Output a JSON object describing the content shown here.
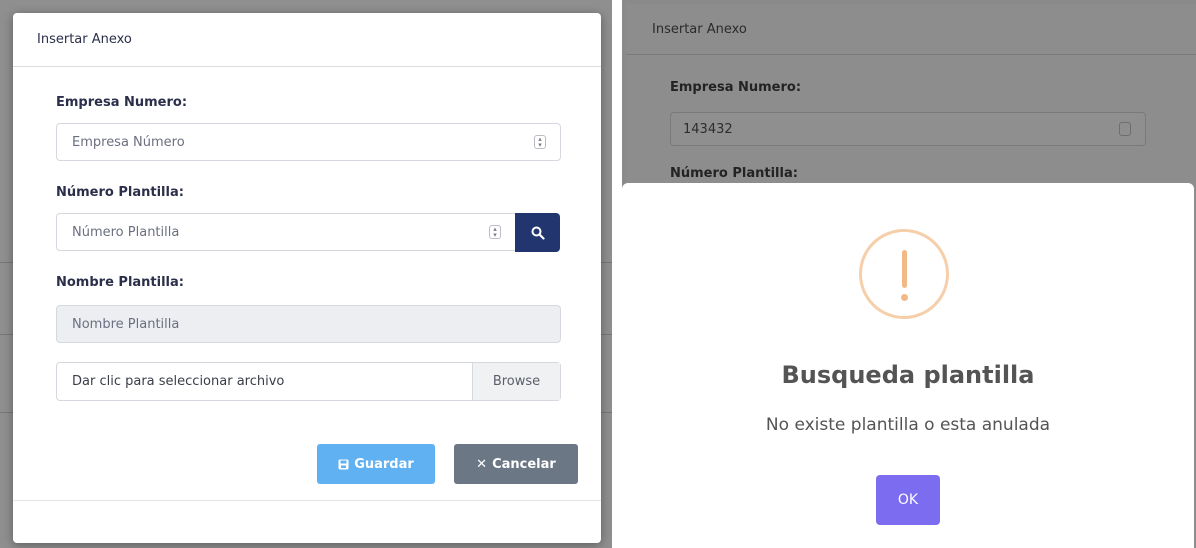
{
  "left_modal": {
    "title": "Insertar Anexo",
    "empresa_label": "Empresa Numero:",
    "empresa_placeholder": "Empresa Número",
    "plantilla_label": "Número Plantilla:",
    "plantilla_placeholder": "Número Plantilla",
    "nombre_label": "Nombre Plantilla:",
    "nombre_placeholder": "Nombre Plantilla",
    "file_placeholder": "Dar clic para seleccionar archivo",
    "browse_label": "Browse",
    "save_label": "Guardar",
    "cancel_label": "Cancelar"
  },
  "right_background": {
    "title": "Insertar Anexo",
    "empresa_label": "Empresa Numero:",
    "empresa_value": "143432",
    "plantilla_label": "Número Plantilla:"
  },
  "alert": {
    "icon": "warning-icon",
    "title": "Busqueda plantilla",
    "message": "No existe plantilla o esta anulada",
    "ok_label": "OK"
  },
  "colors": {
    "search_button": "#23356f",
    "save_button": "#5fb1f2",
    "cancel_button": "#6b7785",
    "ok_button": "#7b6cf0",
    "warning": "#f2b886"
  }
}
